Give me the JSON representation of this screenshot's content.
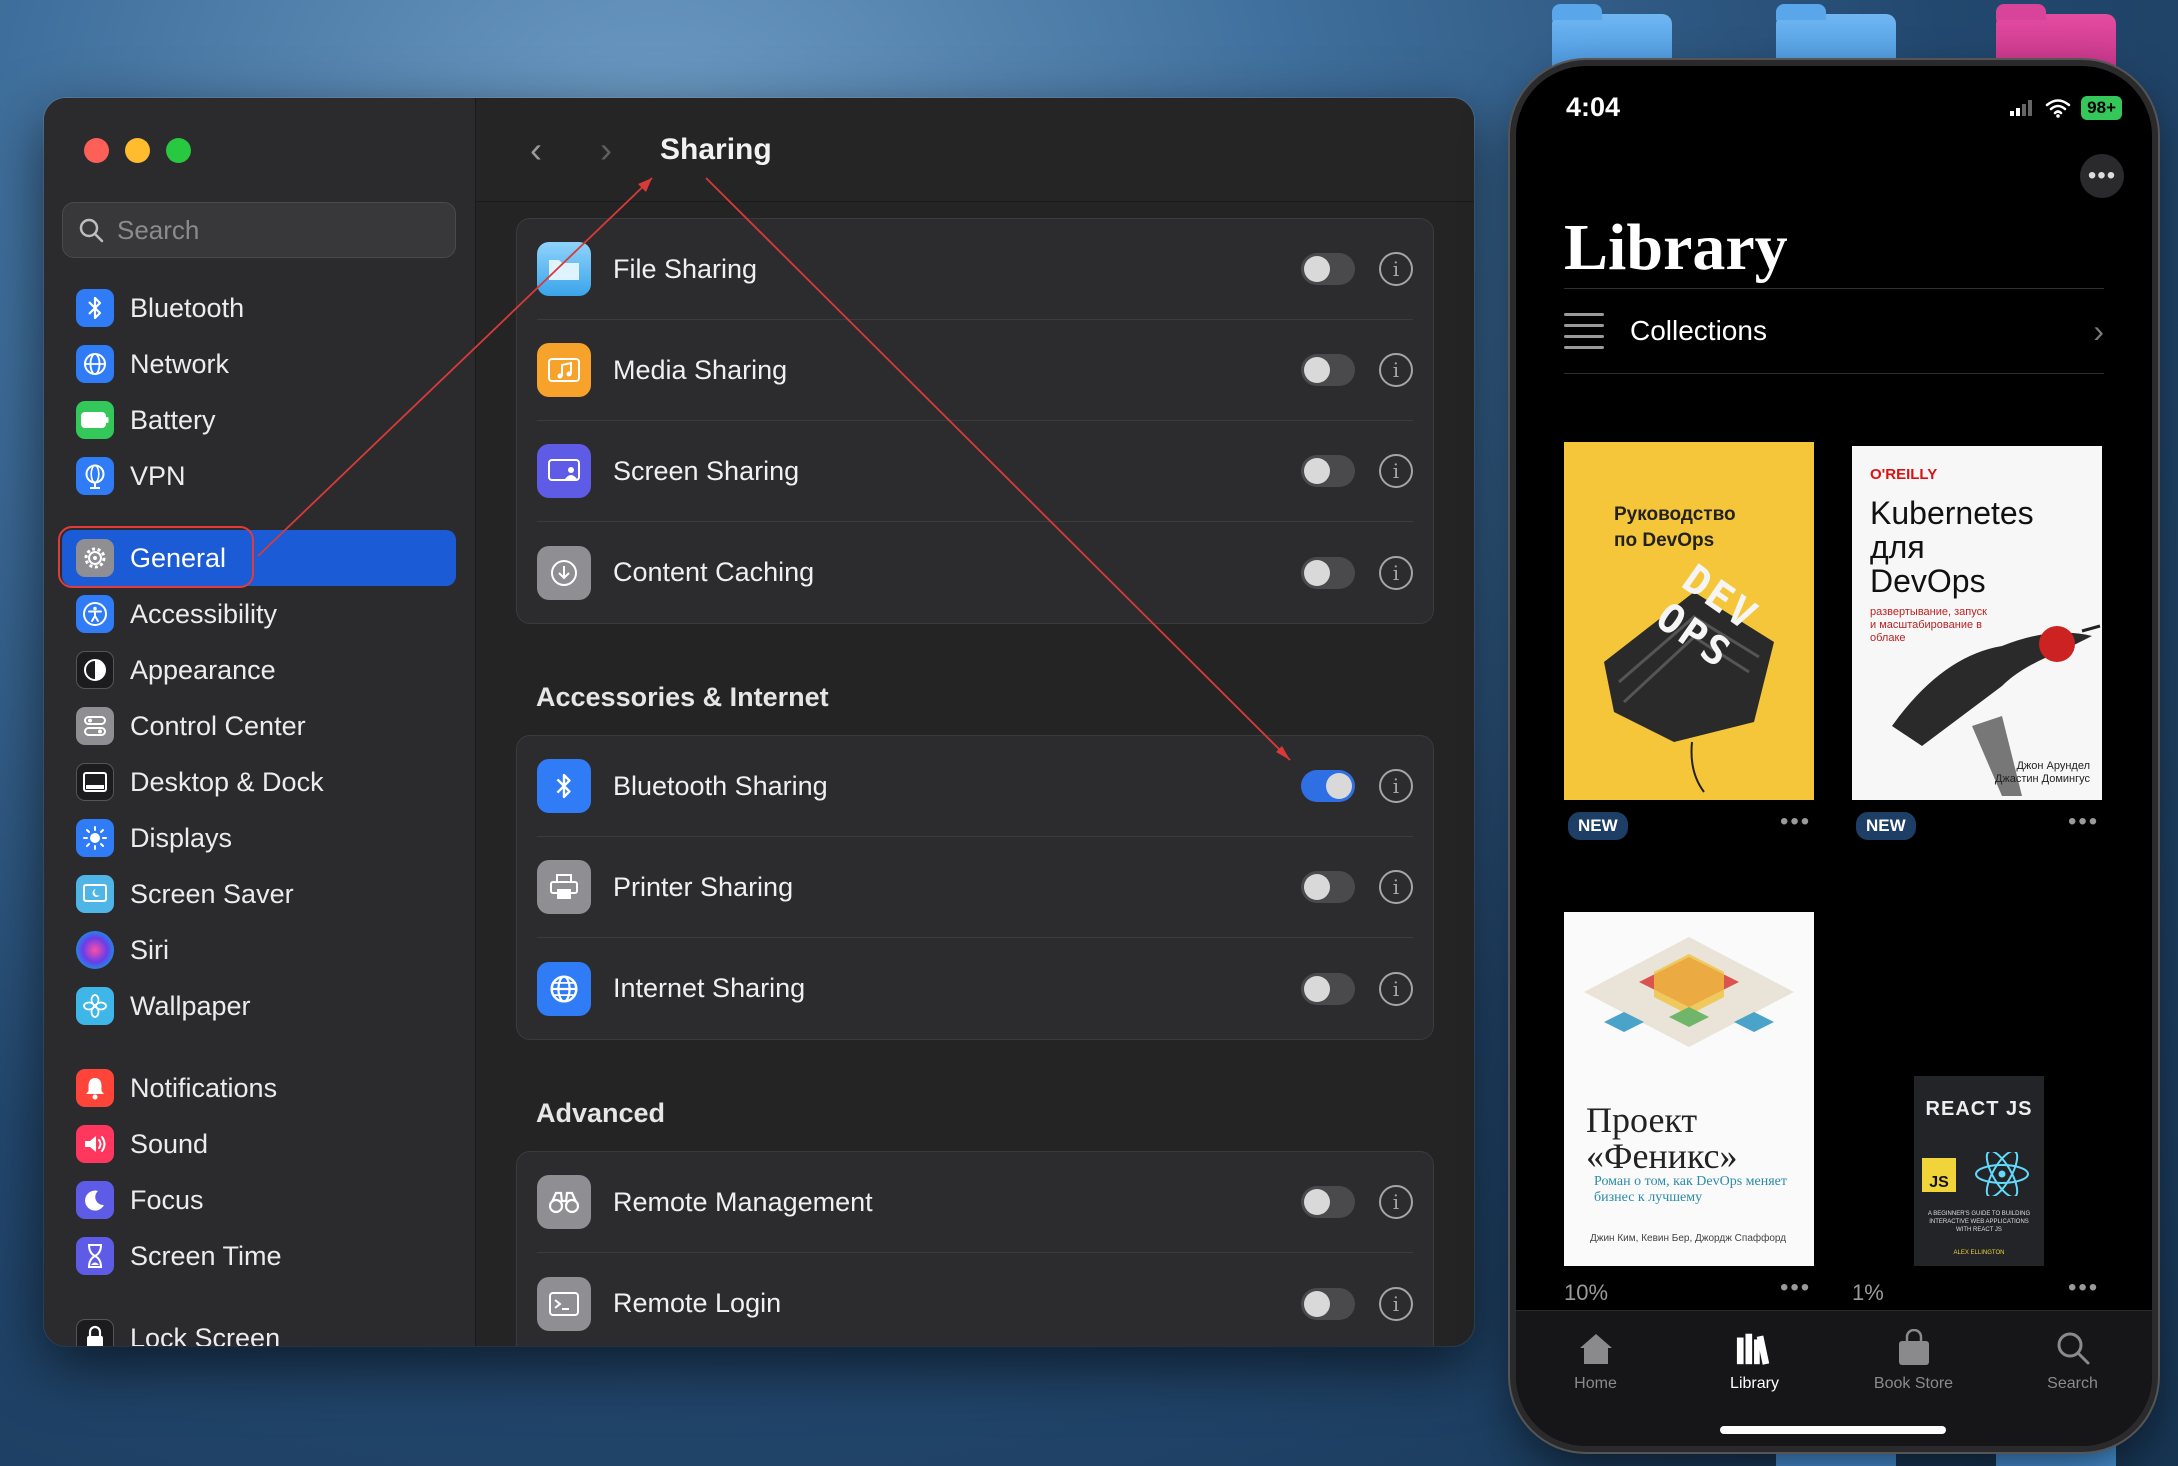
{
  "settings": {
    "search_placeholder": "Search",
    "sidebar": {
      "items": [
        {
          "label": "Bluetooth",
          "icon": "bluetooth-icon",
          "color": "#2f7cf6"
        },
        {
          "label": "Network",
          "icon": "globe-icon",
          "color": "#2f7cf6"
        },
        {
          "label": "Battery",
          "icon": "battery-icon",
          "color": "#34c759"
        },
        {
          "label": "VPN",
          "icon": "vpn-globe-icon",
          "color": "#2f7cf6"
        },
        {
          "label": "General",
          "icon": "gear-icon",
          "color": "#8e8e93",
          "selected": true
        },
        {
          "label": "Accessibility",
          "icon": "accessibility-icon",
          "color": "#2f7cf6"
        },
        {
          "label": "Appearance",
          "icon": "appearance-icon",
          "color": "#1c1c1e"
        },
        {
          "label": "Control Center",
          "icon": "control-center-icon",
          "color": "#8e8e93"
        },
        {
          "label": "Desktop & Dock",
          "icon": "dock-icon",
          "color": "#1c1c1e"
        },
        {
          "label": "Displays",
          "icon": "sun-icon",
          "color": "#2f7cf6"
        },
        {
          "label": "Screen Saver",
          "icon": "screen-saver-icon",
          "color": "#4fb5e6"
        },
        {
          "label": "Siri",
          "icon": "siri-icon",
          "color": "#6a3de8"
        },
        {
          "label": "Wallpaper",
          "icon": "wallpaper-icon",
          "color": "#3fb6e8"
        },
        {
          "label": "Notifications",
          "icon": "bell-icon",
          "color": "#ff453a"
        },
        {
          "label": "Sound",
          "icon": "speaker-icon",
          "color": "#ff375f"
        },
        {
          "label": "Focus",
          "icon": "moon-icon",
          "color": "#5e5ce6"
        },
        {
          "label": "Screen Time",
          "icon": "hourglass-icon",
          "color": "#5e5ce6"
        },
        {
          "label": "Lock Screen",
          "icon": "lock-icon",
          "color": "#1c1c1e"
        }
      ]
    },
    "toolbar": {
      "title": "Sharing",
      "back": "‹",
      "forward": "›"
    },
    "groups": [
      {
        "title": "",
        "rows": [
          {
            "label": "File Sharing",
            "icon": "folder-icon",
            "on": false
          },
          {
            "label": "Media Sharing",
            "icon": "music-icon",
            "on": false
          },
          {
            "label": "Screen Sharing",
            "icon": "screen-share-icon",
            "on": false
          },
          {
            "label": "Content Caching",
            "icon": "caching-icon",
            "on": false
          }
        ]
      },
      {
        "title": "Accessories & Internet",
        "rows": [
          {
            "label": "Bluetooth Sharing",
            "icon": "bluetooth-icon",
            "on": true
          },
          {
            "label": "Printer Sharing",
            "icon": "printer-icon",
            "on": false
          },
          {
            "label": "Internet Sharing",
            "icon": "globe-icon",
            "on": false
          }
        ]
      },
      {
        "title": "Advanced",
        "rows": [
          {
            "label": "Remote Management",
            "icon": "binoculars-icon",
            "on": false
          },
          {
            "label": "Remote Login",
            "icon": "terminal-icon",
            "on": false
          }
        ]
      }
    ],
    "info_glyph": "i"
  },
  "phone": {
    "time": "4:04",
    "battery": "98+",
    "more": "•••",
    "title": "Library",
    "collections": "Collections",
    "books": [
      {
        "title": "Руководство по DevOps",
        "art": "DEV OPS",
        "badge": "NEW",
        "progress": ""
      },
      {
        "publisher": "O'REILLY",
        "title_lines": [
          "Kubernetes",
          "для",
          "DevOps"
        ],
        "subtitle": "развертывание, запуск и масштабирование в облаке",
        "authors": "Джон Арундел Джастин Домингус",
        "badge": "NEW",
        "progress": ""
      },
      {
        "title_lines": [
          "Проект",
          "«Феникс»"
        ],
        "subtitle": "Роман о том, как DevOps меняет бизнес к лучшему",
        "authors": "Джин Ким, Кевин Бер, Джордж Спаффорд",
        "badge": "",
        "progress": "10%"
      },
      {
        "title": "REACT JS",
        "js": "JS",
        "subtitle": "A BEGINNER'S GUIDE TO BUILDING INTERACTIVE WEB APPLICATIONS WITH REACT JS",
        "author": "ALEX ELLINGTON",
        "badge": "",
        "progress": "1%"
      }
    ],
    "tabs": [
      {
        "label": "Home",
        "icon": "house-icon",
        "active": false
      },
      {
        "label": "Library",
        "icon": "books-icon",
        "active": true
      },
      {
        "label": "Book Store",
        "icon": "shopping-bag-icon",
        "active": false
      },
      {
        "label": "Search",
        "icon": "search-icon",
        "active": false
      }
    ]
  }
}
